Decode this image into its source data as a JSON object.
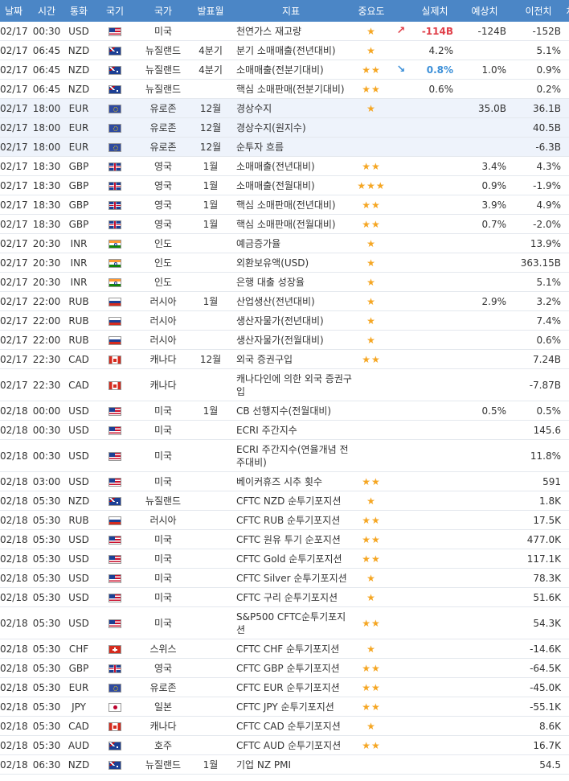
{
  "headers": {
    "date": "날짜",
    "time": "시간",
    "currency": "통화",
    "flag": "국기",
    "country": "국가",
    "period": "발표월",
    "indicator": "지표",
    "importance": "중요도",
    "actual": "실제치",
    "forecast": "예상치",
    "previous": "이전치",
    "extra": "차"
  },
  "rows": [
    {
      "date": "02/17",
      "time": "00:30",
      "cur": "USD",
      "flag": "us",
      "country": "미국",
      "period": "",
      "ind": "천연가스 재고량",
      "stars": 1,
      "trend": "up",
      "actual": "-114B",
      "actual_color": "up",
      "forecast": "-124B",
      "previous": "-152B"
    },
    {
      "date": "02/17",
      "time": "06:45",
      "cur": "NZD",
      "flag": "nz",
      "country": "뉴질랜드",
      "period": "4분기",
      "ind": "분기 소매매출(전년대비)",
      "stars": 1,
      "trend": "",
      "actual": "4.2%",
      "actual_color": "",
      "forecast": "",
      "previous": "5.1%"
    },
    {
      "date": "02/17",
      "time": "06:45",
      "cur": "NZD",
      "flag": "nz",
      "country": "뉴질랜드",
      "period": "4분기",
      "ind": "소매매출(전분기대비)",
      "stars": 2,
      "trend": "down",
      "actual": "0.8%",
      "actual_color": "down",
      "forecast": "1.0%",
      "previous": "0.9%"
    },
    {
      "date": "02/17",
      "time": "06:45",
      "cur": "NZD",
      "flag": "nz",
      "country": "뉴질랜드",
      "period": "",
      "ind": "핵심 소매판매(전분기대비)",
      "stars": 2,
      "trend": "",
      "actual": "0.6%",
      "actual_color": "",
      "forecast": "",
      "previous": "0.2%"
    },
    {
      "date": "02/17",
      "time": "18:00",
      "cur": "EUR",
      "flag": "eu",
      "country": "유로존",
      "period": "12월",
      "ind": "경상수지",
      "stars": 1,
      "trend": "",
      "actual": "",
      "actual_color": "",
      "forecast": "35.0B",
      "previous": "36.1B",
      "hl": true
    },
    {
      "date": "02/17",
      "time": "18:00",
      "cur": "EUR",
      "flag": "eu",
      "country": "유로존",
      "period": "12월",
      "ind": "경상수지(원지수)",
      "stars": 0,
      "trend": "",
      "actual": "",
      "actual_color": "",
      "forecast": "",
      "previous": "40.5B",
      "hl": true
    },
    {
      "date": "02/17",
      "time": "18:00",
      "cur": "EUR",
      "flag": "eu",
      "country": "유로존",
      "period": "12월",
      "ind": "순투자 흐름",
      "stars": 0,
      "trend": "",
      "actual": "",
      "actual_color": "",
      "forecast": "",
      "previous": "-6.3B",
      "hl": true
    },
    {
      "date": "02/17",
      "time": "18:30",
      "cur": "GBP",
      "flag": "gb",
      "country": "영국",
      "period": "1월",
      "ind": "소매매출(전년대비)",
      "stars": 2,
      "trend": "",
      "actual": "",
      "actual_color": "",
      "forecast": "3.4%",
      "previous": "4.3%"
    },
    {
      "date": "02/17",
      "time": "18:30",
      "cur": "GBP",
      "flag": "gb",
      "country": "영국",
      "period": "1월",
      "ind": "소매매출(전월대비)",
      "stars": 3,
      "trend": "",
      "actual": "",
      "actual_color": "",
      "forecast": "0.9%",
      "previous": "-1.9%"
    },
    {
      "date": "02/17",
      "time": "18:30",
      "cur": "GBP",
      "flag": "gb",
      "country": "영국",
      "period": "1월",
      "ind": "핵심 소매판매(전년대비)",
      "stars": 2,
      "trend": "",
      "actual": "",
      "actual_color": "",
      "forecast": "3.9%",
      "previous": "4.9%"
    },
    {
      "date": "02/17",
      "time": "18:30",
      "cur": "GBP",
      "flag": "gb",
      "country": "영국",
      "period": "1월",
      "ind": "핵심 소매판매(전월대비)",
      "stars": 2,
      "trend": "",
      "actual": "",
      "actual_color": "",
      "forecast": "0.7%",
      "previous": "-2.0%"
    },
    {
      "date": "02/17",
      "time": "20:30",
      "cur": "INR",
      "flag": "in",
      "country": "인도",
      "period": "",
      "ind": "예금증가율",
      "stars": 1,
      "trend": "",
      "actual": "",
      "actual_color": "",
      "forecast": "",
      "previous": "13.9%"
    },
    {
      "date": "02/17",
      "time": "20:30",
      "cur": "INR",
      "flag": "in",
      "country": "인도",
      "period": "",
      "ind": "외환보유액(USD)",
      "stars": 1,
      "trend": "",
      "actual": "",
      "actual_color": "",
      "forecast": "",
      "previous": "363.15B"
    },
    {
      "date": "02/17",
      "time": "20:30",
      "cur": "INR",
      "flag": "in",
      "country": "인도",
      "period": "",
      "ind": "은행 대출 성장율",
      "stars": 1,
      "trend": "",
      "actual": "",
      "actual_color": "",
      "forecast": "",
      "previous": "5.1%"
    },
    {
      "date": "02/17",
      "time": "22:00",
      "cur": "RUB",
      "flag": "ru",
      "country": "러시아",
      "period": "1월",
      "ind": "산업생산(전년대비)",
      "stars": 1,
      "trend": "",
      "actual": "",
      "actual_color": "",
      "forecast": "2.9%",
      "previous": "3.2%"
    },
    {
      "date": "02/17",
      "time": "22:00",
      "cur": "RUB",
      "flag": "ru",
      "country": "러시아",
      "period": "",
      "ind": "생산자물가(전년대비)",
      "stars": 1,
      "trend": "",
      "actual": "",
      "actual_color": "",
      "forecast": "",
      "previous": "7.4%"
    },
    {
      "date": "02/17",
      "time": "22:00",
      "cur": "RUB",
      "flag": "ru",
      "country": "러시아",
      "period": "",
      "ind": "생산자물가(전월대비)",
      "stars": 1,
      "trend": "",
      "actual": "",
      "actual_color": "",
      "forecast": "",
      "previous": "0.6%"
    },
    {
      "date": "02/17",
      "time": "22:30",
      "cur": "CAD",
      "flag": "ca",
      "country": "캐나다",
      "period": "12월",
      "ind": "외국 증권구입",
      "stars": 2,
      "trend": "",
      "actual": "",
      "actual_color": "",
      "forecast": "",
      "previous": "7.24B"
    },
    {
      "date": "02/17",
      "time": "22:30",
      "cur": "CAD",
      "flag": "ca",
      "country": "캐나다",
      "period": "",
      "ind": "캐나다인에 의한 외국 증권구입",
      "stars": 0,
      "trend": "",
      "actual": "",
      "actual_color": "",
      "forecast": "",
      "previous": "-7.87B",
      "tall": true
    },
    {
      "date": "02/18",
      "time": "00:00",
      "cur": "USD",
      "flag": "us",
      "country": "미국",
      "period": "1월",
      "ind": "CB 선행지수(전월대비)",
      "stars": 0,
      "trend": "",
      "actual": "",
      "actual_color": "",
      "forecast": "0.5%",
      "previous": "0.5%"
    },
    {
      "date": "02/18",
      "time": "00:30",
      "cur": "USD",
      "flag": "us",
      "country": "미국",
      "period": "",
      "ind": "ECRI 주간지수",
      "stars": 0,
      "trend": "",
      "actual": "",
      "actual_color": "",
      "forecast": "",
      "previous": "145.6"
    },
    {
      "date": "02/18",
      "time": "00:30",
      "cur": "USD",
      "flag": "us",
      "country": "미국",
      "period": "",
      "ind": "ECRI 주간지수(연율개념 전주대비)",
      "stars": 0,
      "trend": "",
      "actual": "",
      "actual_color": "",
      "forecast": "",
      "previous": "11.8%",
      "tall": true
    },
    {
      "date": "02/18",
      "time": "03:00",
      "cur": "USD",
      "flag": "us",
      "country": "미국",
      "period": "",
      "ind": "베이커휴즈 시추 횟수",
      "stars": 2,
      "trend": "",
      "actual": "",
      "actual_color": "",
      "forecast": "",
      "previous": "591"
    },
    {
      "date": "02/18",
      "time": "05:30",
      "cur": "NZD",
      "flag": "nz",
      "country": "뉴질랜드",
      "period": "",
      "ind": "CFTC NZD 순투기포지션",
      "stars": 1,
      "trend": "",
      "actual": "",
      "actual_color": "",
      "forecast": "",
      "previous": "1.8K"
    },
    {
      "date": "02/18",
      "time": "05:30",
      "cur": "RUB",
      "flag": "ru",
      "country": "러시아",
      "period": "",
      "ind": "CFTC RUB 순투기포지션",
      "stars": 2,
      "trend": "",
      "actual": "",
      "actual_color": "",
      "forecast": "",
      "previous": "17.5K"
    },
    {
      "date": "02/18",
      "time": "05:30",
      "cur": "USD",
      "flag": "us",
      "country": "미국",
      "period": "",
      "ind": "CFTC 원유 투기 순포지션",
      "stars": 2,
      "trend": "",
      "actual": "",
      "actual_color": "",
      "forecast": "",
      "previous": "477.0K"
    },
    {
      "date": "02/18",
      "time": "05:30",
      "cur": "USD",
      "flag": "us",
      "country": "미국",
      "period": "",
      "ind": "CFTC Gold 순투기포지션",
      "stars": 2,
      "trend": "",
      "actual": "",
      "actual_color": "",
      "forecast": "",
      "previous": "117.1K"
    },
    {
      "date": "02/18",
      "time": "05:30",
      "cur": "USD",
      "flag": "us",
      "country": "미국",
      "period": "",
      "ind": "CFTC Silver 순투기포지션",
      "stars": 1,
      "trend": "",
      "actual": "",
      "actual_color": "",
      "forecast": "",
      "previous": "78.3K"
    },
    {
      "date": "02/18",
      "time": "05:30",
      "cur": "USD",
      "flag": "us",
      "country": "미국",
      "period": "",
      "ind": "CFTC 구리 순투기포지션",
      "stars": 1,
      "trend": "",
      "actual": "",
      "actual_color": "",
      "forecast": "",
      "previous": "51.6K"
    },
    {
      "date": "02/18",
      "time": "05:30",
      "cur": "USD",
      "flag": "us",
      "country": "미국",
      "period": "",
      "ind": "S&P500 CFTC순투기포지션",
      "stars": 2,
      "trend": "",
      "actual": "",
      "actual_color": "",
      "forecast": "",
      "previous": "54.3K",
      "tall": true
    },
    {
      "date": "02/18",
      "time": "05:30",
      "cur": "CHF",
      "flag": "ch",
      "country": "스위스",
      "period": "",
      "ind": "CFTC CHF 순투기포지션",
      "stars": 1,
      "trend": "",
      "actual": "",
      "actual_color": "",
      "forecast": "",
      "previous": "-14.6K"
    },
    {
      "date": "02/18",
      "time": "05:30",
      "cur": "GBP",
      "flag": "gb",
      "country": "영국",
      "period": "",
      "ind": "CFTC GBP 순투기포지션",
      "stars": 2,
      "trend": "",
      "actual": "",
      "actual_color": "",
      "forecast": "",
      "previous": "-64.5K"
    },
    {
      "date": "02/18",
      "time": "05:30",
      "cur": "EUR",
      "flag": "eu",
      "country": "유로존",
      "period": "",
      "ind": "CFTC EUR 순투기포지션",
      "stars": 2,
      "trend": "",
      "actual": "",
      "actual_color": "",
      "forecast": "",
      "previous": "-45.0K"
    },
    {
      "date": "02/18",
      "time": "05:30",
      "cur": "JPY",
      "flag": "jp",
      "country": "일본",
      "period": "",
      "ind": "CFTC JPY 순투기포지션",
      "stars": 2,
      "trend": "",
      "actual": "",
      "actual_color": "",
      "forecast": "",
      "previous": "-55.1K"
    },
    {
      "date": "02/18",
      "time": "05:30",
      "cur": "CAD",
      "flag": "ca",
      "country": "캐나다",
      "period": "",
      "ind": "CFTC CAD 순투기포지션",
      "stars": 1,
      "trend": "",
      "actual": "",
      "actual_color": "",
      "forecast": "",
      "previous": "8.6K"
    },
    {
      "date": "02/18",
      "time": "05:30",
      "cur": "AUD",
      "flag": "au",
      "country": "호주",
      "period": "",
      "ind": "CFTC AUD 순투기포지션",
      "stars": 2,
      "trend": "",
      "actual": "",
      "actual_color": "",
      "forecast": "",
      "previous": "16.7K"
    },
    {
      "date": "02/18",
      "time": "06:30",
      "cur": "NZD",
      "flag": "nz",
      "country": "뉴질랜드",
      "period": "1월",
      "ind": "기업 NZ PMI",
      "stars": 0,
      "trend": "",
      "actual": "",
      "actual_color": "",
      "forecast": "",
      "previous": "54.5"
    }
  ],
  "colors": {
    "header_bg": "#4b86c6",
    "star": "#f5a623",
    "up": "#e0404a",
    "down": "#3b8fd8",
    "highlight_row": "#eef3fb"
  }
}
